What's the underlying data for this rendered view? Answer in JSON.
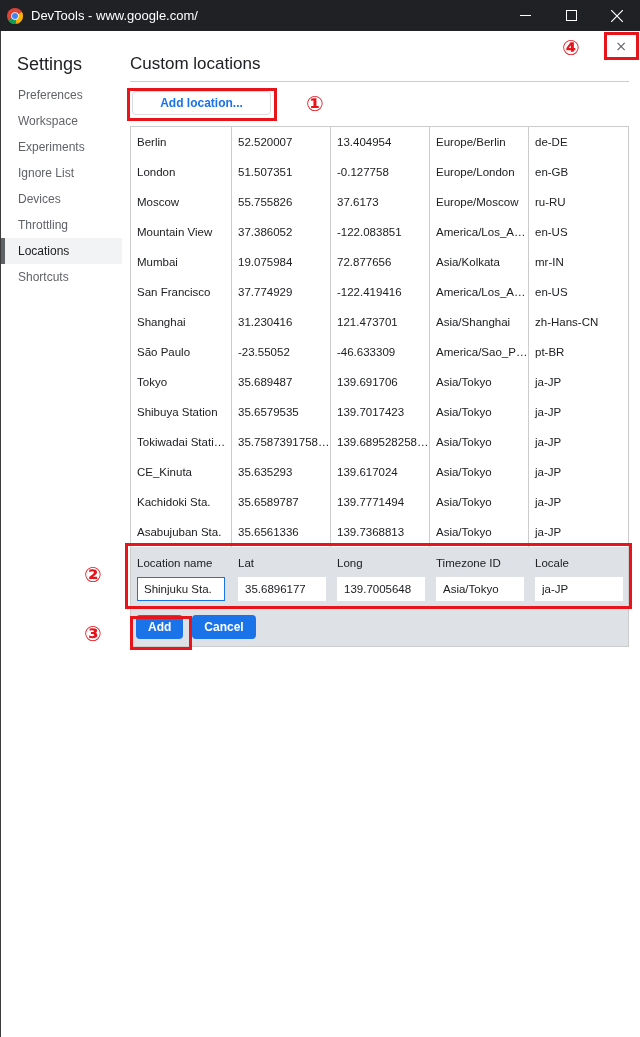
{
  "window": {
    "title": "DevTools - www.google.com/"
  },
  "sidebar": {
    "title": "Settings",
    "items": [
      {
        "label": "Preferences",
        "selected": false
      },
      {
        "label": "Workspace",
        "selected": false
      },
      {
        "label": "Experiments",
        "selected": false
      },
      {
        "label": "Ignore List",
        "selected": false
      },
      {
        "label": "Devices",
        "selected": false
      },
      {
        "label": "Throttling",
        "selected": false
      },
      {
        "label": "Locations",
        "selected": true
      },
      {
        "label": "Shortcuts",
        "selected": false
      }
    ]
  },
  "panel": {
    "title": "Custom locations",
    "add_button": "Add location...",
    "close_button": "×"
  },
  "table": {
    "rows": [
      [
        "Berlin",
        "52.520007",
        "13.404954",
        "Europe/Berlin",
        "de-DE"
      ],
      [
        "London",
        "51.507351",
        "-0.127758",
        "Europe/London",
        "en-GB"
      ],
      [
        "Moscow",
        "55.755826",
        "37.6173",
        "Europe/Moscow",
        "ru-RU"
      ],
      [
        "Mountain View",
        "37.386052",
        "-122.083851",
        "America/Los_A…",
        "en-US"
      ],
      [
        "Mumbai",
        "19.075984",
        "72.877656",
        "Asia/Kolkata",
        "mr-IN"
      ],
      [
        "San Francisco",
        "37.774929",
        "-122.419416",
        "America/Los_A…",
        "en-US"
      ],
      [
        "Shanghai",
        "31.230416",
        "121.473701",
        "Asia/Shanghai",
        "zh-Hans-CN"
      ],
      [
        "São Paulo",
        "-23.55052",
        "-46.633309",
        "America/Sao_P…",
        "pt-BR"
      ],
      [
        "Tokyo",
        "35.689487",
        "139.691706",
        "Asia/Tokyo",
        "ja-JP"
      ],
      [
        "Shibuya Station",
        "35.6579535",
        "139.7017423",
        "Asia/Tokyo",
        "ja-JP"
      ],
      [
        "Tokiwadai Stati…",
        "35.7587391758…",
        "139.689528258…",
        "Asia/Tokyo",
        "ja-JP"
      ],
      [
        "CE_Kinuta",
        "35.635293",
        "139.617024",
        "Asia/Tokyo",
        "ja-JP"
      ],
      [
        "Kachidoki Sta.",
        "35.6589787",
        "139.7771494",
        "Asia/Tokyo",
        "ja-JP"
      ],
      [
        "Asabujuban Sta.",
        "35.6561336",
        "139.7368813",
        "Asia/Tokyo",
        "ja-JP"
      ]
    ]
  },
  "editor": {
    "fields": [
      {
        "label": "Location name",
        "value": "Shinjuku Sta.",
        "focused": true
      },
      {
        "label": "Lat",
        "value": "35.6896177",
        "focused": false
      },
      {
        "label": "Long",
        "value": "139.7005648",
        "focused": false
      },
      {
        "label": "Timezone ID",
        "value": "Asia/Tokyo",
        "focused": false
      },
      {
        "label": "Locale",
        "value": "ja-JP",
        "focused": false
      }
    ],
    "buttons": [
      {
        "label": "Add",
        "kind": "primary"
      },
      {
        "label": "Cancel",
        "kind": "primary"
      }
    ]
  },
  "annotations": [
    {
      "label": "①"
    },
    {
      "label": "②"
    },
    {
      "label": "③"
    },
    {
      "label": "④"
    }
  ]
}
